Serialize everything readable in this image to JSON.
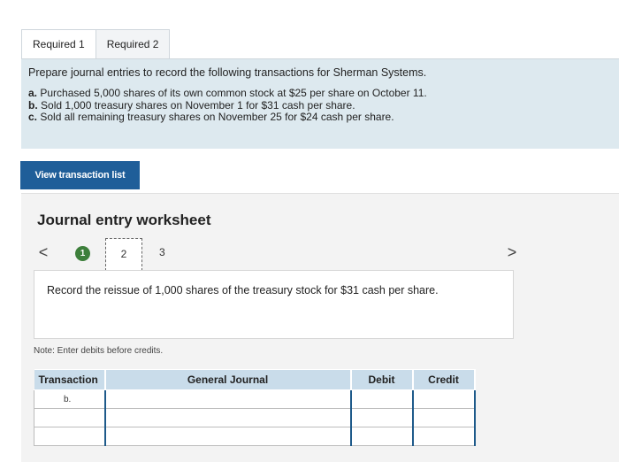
{
  "tabs": [
    {
      "label": "Required 1",
      "active": true
    },
    {
      "label": "Required 2",
      "active": false
    }
  ],
  "prompt": {
    "intro": "Prepare journal entries to record the following transactions for Sherman Systems.",
    "items": [
      {
        "letter": "a.",
        "text": "Purchased 5,000 shares of its own common stock at $25 per share on October 11."
      },
      {
        "letter": "b.",
        "text": "Sold 1,000 treasury shares on November 1 for $31 cash per share."
      },
      {
        "letter": "c.",
        "text": "Sold all remaining treasury shares on November 25 for $24 cash per share."
      }
    ]
  },
  "view_button": {
    "label": "View transaction list"
  },
  "worksheet": {
    "title": "Journal entry worksheet",
    "nav_prev": "<",
    "nav_next": ">",
    "steps": [
      "1",
      "2",
      "3"
    ],
    "instruction": "Record the reissue of 1,000 shares of the treasury stock for $31 cash per share.",
    "note": "Note: Enter debits before credits."
  },
  "journal": {
    "headers": {
      "transaction": "Transaction",
      "general_journal": "General Journal",
      "debit": "Debit",
      "credit": "Credit"
    },
    "rows": [
      {
        "transaction": "b.",
        "account": "",
        "debit": "",
        "credit": ""
      },
      {
        "transaction": "",
        "account": "",
        "debit": "",
        "credit": ""
      },
      {
        "transaction": "",
        "account": "",
        "debit": "",
        "credit": ""
      }
    ]
  },
  "colors": {
    "accent": "#1f5e99",
    "prompt_bg": "#dde9ef",
    "step_done": "#3d7f3b",
    "table_header": "#c9dcea"
  }
}
